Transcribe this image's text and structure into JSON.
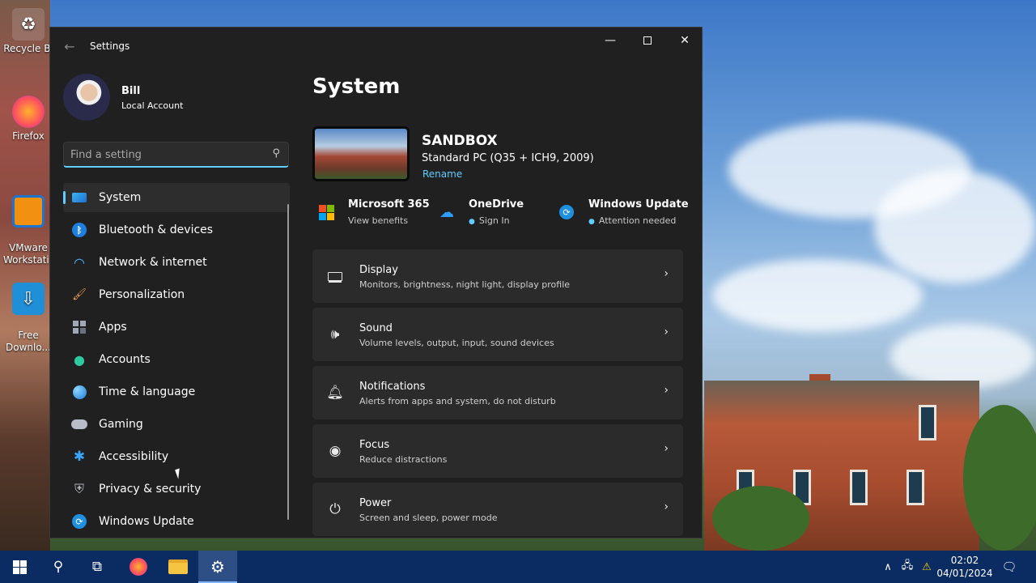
{
  "desktop": {
    "icons": [
      {
        "label": "Recycle Bi",
        "icon": "recycle-bin-icon"
      },
      {
        "label": "Firefox",
        "icon": "firefox-icon"
      },
      {
        "label": "VMware\nWorkstati...",
        "icon": "vmware-icon"
      },
      {
        "label": "Free\nDownlo...",
        "icon": "download-icon"
      }
    ]
  },
  "window": {
    "title": "Settings"
  },
  "profile": {
    "name": "Bill",
    "account_type": "Local Account"
  },
  "search": {
    "placeholder": "Find a setting"
  },
  "nav": {
    "items": [
      {
        "label": "System",
        "icon": "monitor-icon",
        "active": true
      },
      {
        "label": "Bluetooth & devices",
        "icon": "bluetooth-icon"
      },
      {
        "label": "Network & internet",
        "icon": "wifi-icon"
      },
      {
        "label": "Personalization",
        "icon": "brush-icon"
      },
      {
        "label": "Apps",
        "icon": "apps-icon"
      },
      {
        "label": "Accounts",
        "icon": "person-icon"
      },
      {
        "label": "Time & language",
        "icon": "globe-clock-icon"
      },
      {
        "label": "Gaming",
        "icon": "gamepad-icon"
      },
      {
        "label": "Accessibility",
        "icon": "accessibility-icon"
      },
      {
        "label": "Privacy & security",
        "icon": "shield-icon"
      },
      {
        "label": "Windows Update",
        "icon": "update-icon"
      }
    ]
  },
  "main": {
    "title": "System",
    "device": {
      "name": "SANDBOX",
      "model": "Standard PC (Q35 + ICH9, 2009)",
      "rename": "Rename"
    },
    "quick": [
      {
        "title": "Microsoft 365",
        "sub": "View benefits",
        "icon": "microsoft-logo-icon"
      },
      {
        "title": "OneDrive",
        "sub": "Sign In",
        "icon": "onedrive-cloud-icon"
      },
      {
        "title": "Windows Update",
        "sub": "Attention needed",
        "icon": "windows-update-icon"
      }
    ],
    "cards": [
      {
        "title": "Display",
        "sub": "Monitors, brightness, night light, display profile",
        "icon": "laptop-icon"
      },
      {
        "title": "Sound",
        "sub": "Volume levels, output, input, sound devices",
        "icon": "speaker-icon"
      },
      {
        "title": "Notifications",
        "sub": "Alerts from apps and system, do not disturb",
        "icon": "bell-icon"
      },
      {
        "title": "Focus",
        "sub": "Reduce distractions",
        "icon": "focus-icon"
      },
      {
        "title": "Power",
        "sub": "Screen and sleep, power mode",
        "icon": "power-icon"
      }
    ]
  },
  "taskbar": {
    "time": "02:02",
    "date": "04/01/2024"
  },
  "colors": {
    "accent": "#60cdff",
    "window_bg": "#202020",
    "card_bg": "#2b2b2b",
    "taskbar_bg": "#0b2b63"
  }
}
